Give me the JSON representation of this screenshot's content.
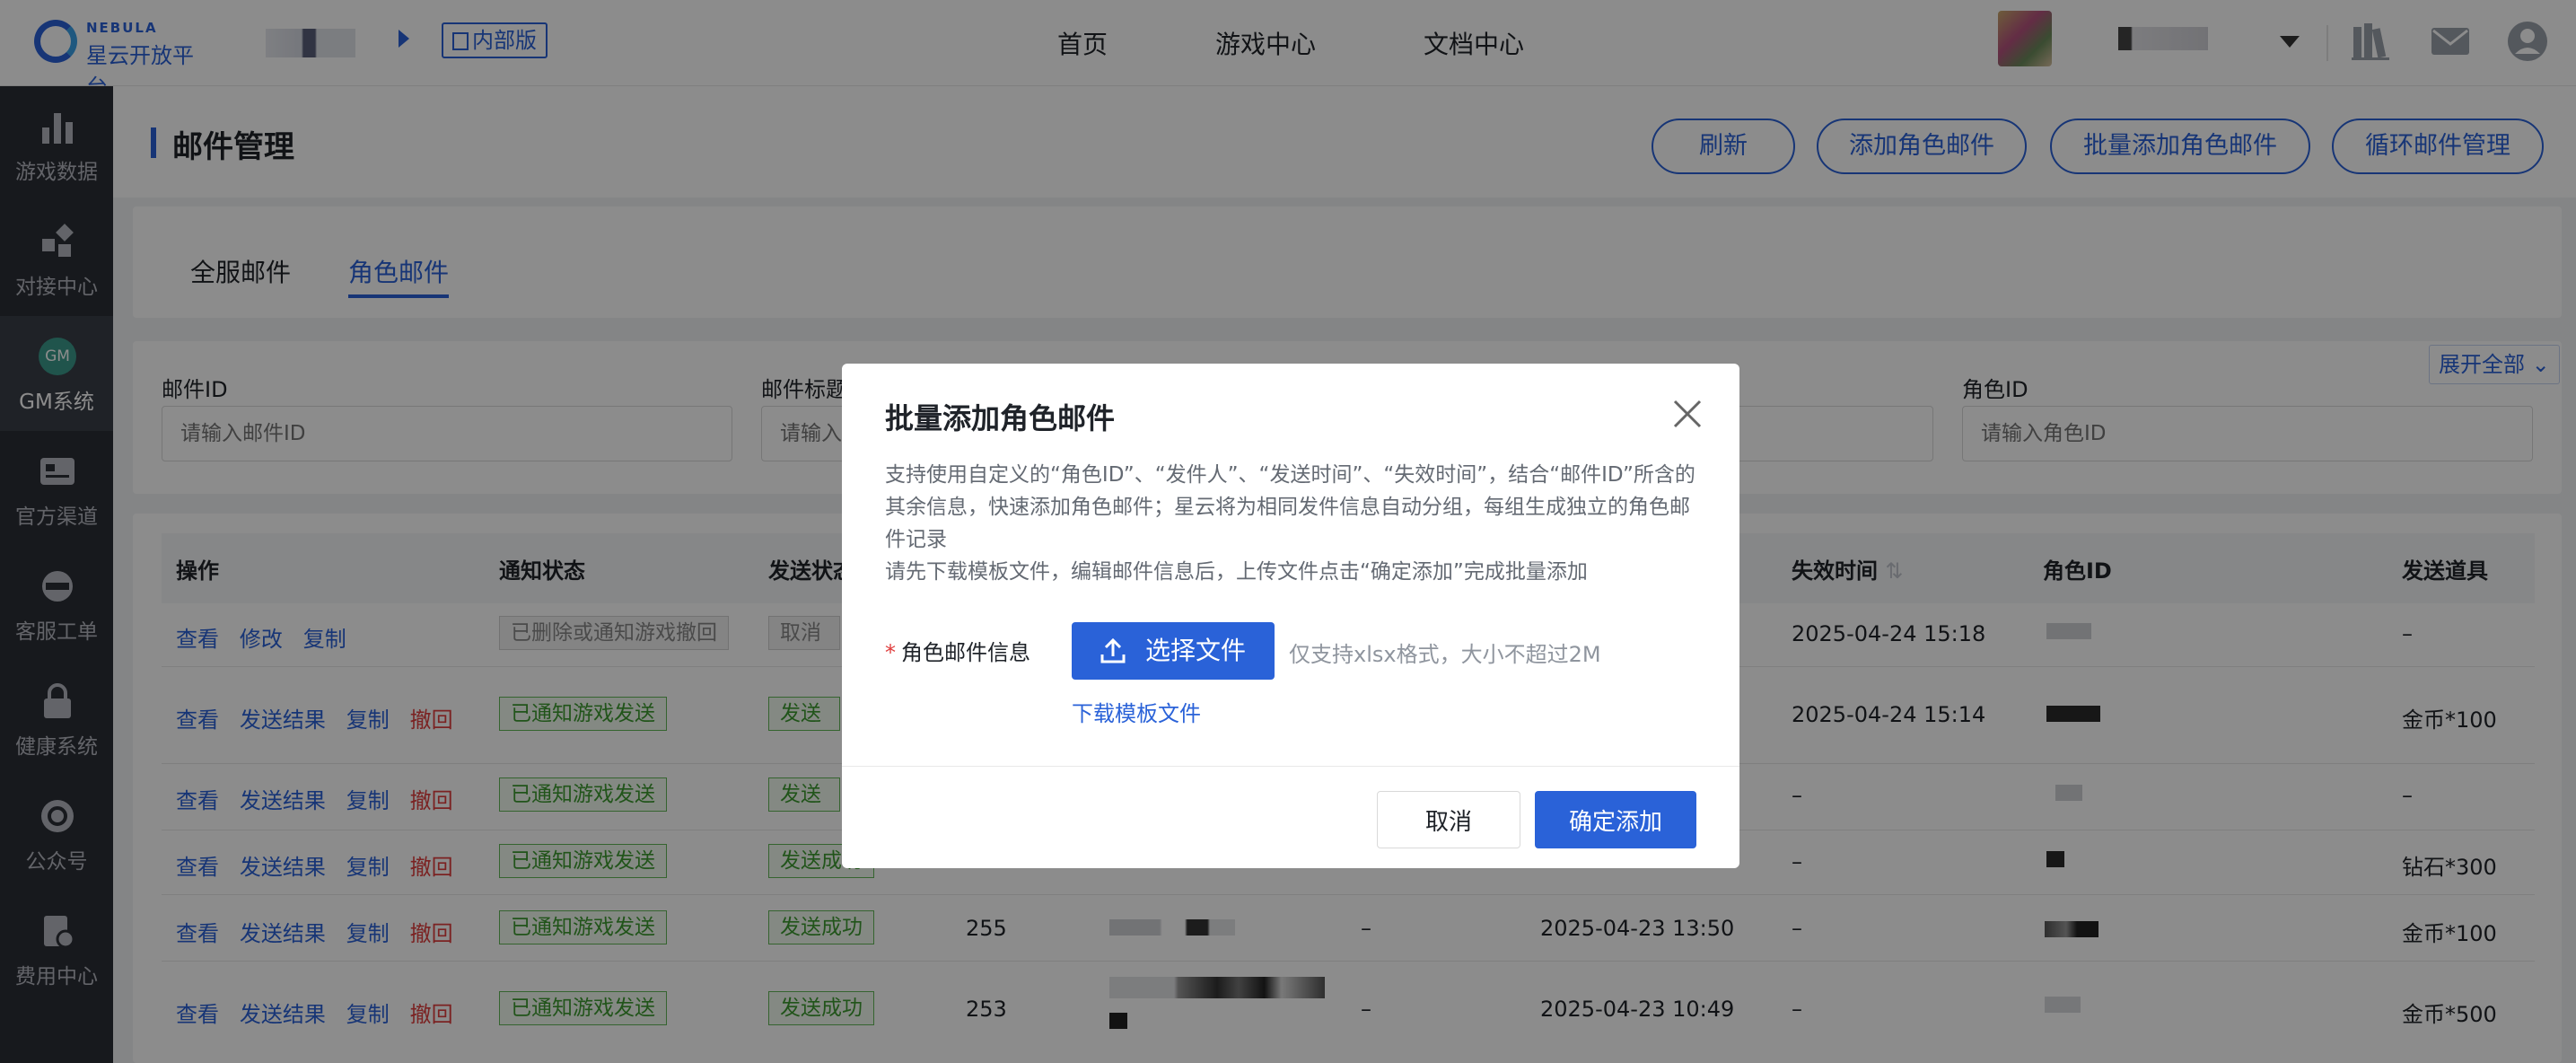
{
  "brand": {
    "name_en": "NEBULA",
    "name_cn": "星云开放平台",
    "badge": "内部版"
  },
  "nav": {
    "home": "首页",
    "games": "游戏中心",
    "docs": "文档中心"
  },
  "sidebar": {
    "items": [
      {
        "label": "游戏数据",
        "icon": "bar-chart-icon"
      },
      {
        "label": "对接中心",
        "icon": "puzzle-icon"
      },
      {
        "label": "GM系统",
        "icon": "gm-icon",
        "icon_text": "GM"
      },
      {
        "label": "官方渠道",
        "icon": "id-card-icon"
      },
      {
        "label": "客服工单",
        "icon": "support-icon"
      },
      {
        "label": "健康系统",
        "icon": "lock-icon"
      },
      {
        "label": "公众号",
        "icon": "refresh-circle-icon"
      },
      {
        "label": "费用中心",
        "icon": "bill-icon"
      }
    ]
  },
  "page": {
    "title": "邮件管理",
    "actions": {
      "refresh": "刷新",
      "add_role_mail": "添加角色邮件",
      "batch_add": "批量添加角色邮件",
      "loop_mail": "循环邮件管理"
    },
    "tabs": [
      "全服邮件",
      "角色邮件"
    ],
    "expand_all": "展开全部"
  },
  "filters": {
    "mail_id": {
      "label": "邮件ID",
      "placeholder": "请输入邮件ID"
    },
    "mail_title": {
      "label": "邮件标题",
      "placeholder": "请输入"
    },
    "role_id": {
      "label": "角色ID",
      "placeholder": "请输入角色ID"
    }
  },
  "table": {
    "headers": {
      "ops": "操作",
      "notify": "通知状态",
      "send": "发送状态",
      "expire": "失效时间",
      "role": "角色ID",
      "items": "发送道具"
    },
    "op_labels": {
      "view": "查看",
      "edit": "修改",
      "copy": "复制",
      "result": "发送结果",
      "revoke": "撤回"
    },
    "rows": [
      {
        "notify": "已删除或通知游戏撤回",
        "send": "取消发",
        "id": "",
        "sender": "",
        "time": "",
        "expire": "2025-04-24 15:18",
        "items": "–"
      },
      {
        "notify": "已通知游戏发送",
        "send": "发送成",
        "id": "",
        "sender": "",
        "time": "",
        "expire": "2025-04-24 15:14",
        "items": "金币*100"
      },
      {
        "notify": "已通知游戏发送",
        "send": "发送成",
        "id": "",
        "sender": "",
        "time": "",
        "expire": "–",
        "items": "–"
      },
      {
        "notify": "已通知游戏发送",
        "send": "发送成功",
        "id": "",
        "sender": "",
        "time": "",
        "expire": "–",
        "items": "钻石*300"
      },
      {
        "notify": "已通知游戏发送",
        "send": "发送成功",
        "id": "255",
        "sender": "–",
        "time": "2025-04-23 13:50",
        "expire": "–",
        "items": "金币*100"
      },
      {
        "notify": "已通知游戏发送",
        "send": "发送成功",
        "id": "253",
        "sender": "–",
        "time": "2025-04-23 10:49",
        "expire": "–",
        "items": "金币*500"
      }
    ]
  },
  "modal": {
    "title": "批量添加角色邮件",
    "desc1": "支持使用自定义的“角色ID”、“发件人”、“发送时间”、“失效时间”，结合“邮件ID”所含的其余信息，快速添加角色邮件；星云将为相同发件信息自动分组，每组生成独立的角色邮件记录",
    "desc2": "请先下载模板文件，编辑邮件信息后，上传文件点击“确定添加”完成批量添加",
    "field_label": "角色邮件信息",
    "upload_label": "选择文件",
    "hint": "仅支持xlsx格式，大小不超过2M",
    "download": "下载模板文件",
    "cancel": "取消",
    "confirm": "确定添加"
  },
  "colors": {
    "primary": "#2a62d8",
    "sidebar": "#2b2e36",
    "danger": "#e03e3e",
    "success": "#3d9a31"
  }
}
